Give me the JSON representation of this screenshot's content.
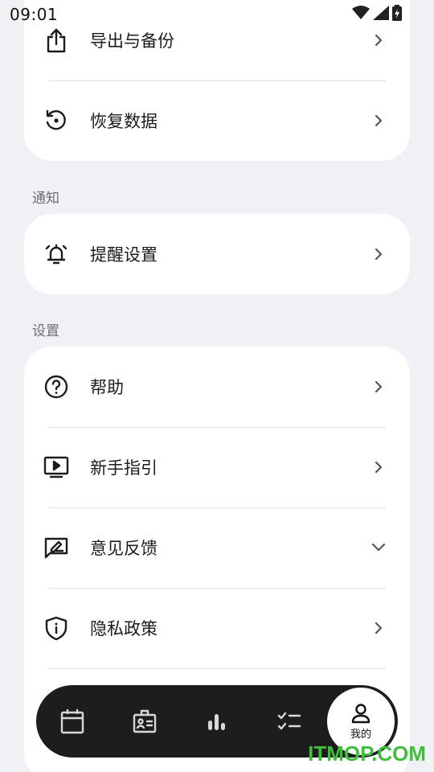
{
  "status_bar": {
    "time": "09:01",
    "icons": [
      "wifi-icon",
      "signal-icon",
      "battery-charging-icon"
    ]
  },
  "groups": [
    {
      "title": "",
      "items": [
        {
          "label": "导出与备份",
          "icon": "share-upload-icon",
          "trailing": "chevron-right-icon"
        },
        {
          "label": "恢复数据",
          "icon": "restore-icon",
          "trailing": "chevron-right-icon"
        }
      ]
    },
    {
      "title": "通知",
      "items": [
        {
          "label": "提醒设置",
          "icon": "alarm-bell-icon",
          "trailing": "chevron-right-icon"
        }
      ]
    },
    {
      "title": "设置",
      "items": [
        {
          "label": "帮助",
          "icon": "help-circle-icon",
          "trailing": "chevron-right-icon"
        },
        {
          "label": "新手指引",
          "icon": "play-screen-icon",
          "trailing": "chevron-right-icon"
        },
        {
          "label": "意见反馈",
          "icon": "feedback-edit-icon",
          "trailing": "chevron-down-icon"
        },
        {
          "label": "隐私政策",
          "icon": "shield-info-icon",
          "trailing": "chevron-right-icon"
        }
      ]
    }
  ],
  "tabbar": {
    "tabs": [
      {
        "icon": "calendar-icon"
      },
      {
        "icon": "id-card-icon"
      },
      {
        "icon": "bar-chart-icon"
      },
      {
        "icon": "checklist-icon"
      },
      {
        "icon": "profile-icon",
        "label": "我的",
        "active": true
      }
    ]
  },
  "watermark": "ITMOP.COM",
  "colors": {
    "background": "#f0f1f5",
    "card": "#ffffff",
    "tabbar": "#1d1d1f",
    "watermark": "#3fbf3a"
  }
}
